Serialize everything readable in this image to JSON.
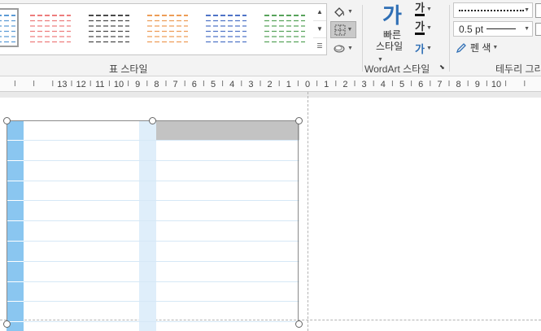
{
  "ribbon": {
    "table_styles": {
      "group_label": "표 스타일",
      "styles": [
        {
          "name": "style-1",
          "color": "#5b9bd5"
        },
        {
          "name": "style-2",
          "color": "#ed7d7d"
        },
        {
          "name": "style-3",
          "color": "#4a4a4a"
        },
        {
          "name": "style-4",
          "color": "#ed9d57"
        },
        {
          "name": "style-5",
          "color": "#4f74c7"
        },
        {
          "name": "style-6",
          "color": "#57a35a"
        }
      ]
    },
    "wordart": {
      "group_label": "WordArt 스타일",
      "quick_styles_glyph": "가",
      "quick_styles_label1": "빠른",
      "quick_styles_label2": "스타일",
      "text_fill_glyph": "가",
      "text_outline_glyph": "가",
      "text_effects_glyph": "가"
    },
    "borders": {
      "group_label": "테두리 그리기",
      "pen_weight": "0.5 pt",
      "pen_color_label": "펜 색"
    }
  },
  "ruler": {
    "left_labels": [
      "13",
      "12",
      "11",
      "10",
      "9",
      "8",
      "7",
      "6",
      "5",
      "4",
      "3",
      "2",
      "1"
    ],
    "zero": "0",
    "right_labels": [
      "1",
      "2",
      "3",
      "4",
      "5",
      "6",
      "7",
      "8",
      "9",
      "10"
    ]
  }
}
